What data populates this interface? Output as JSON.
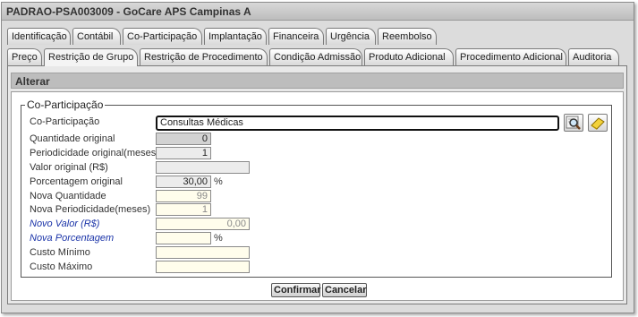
{
  "window": {
    "title": "PADRAO-PSA003009 - GoCare APS Campinas A"
  },
  "tabs_row1": [
    {
      "label": "Identificação"
    },
    {
      "label": "Contábil"
    },
    {
      "label": "Co-Participação"
    },
    {
      "label": "Implantação"
    },
    {
      "label": "Financeira"
    },
    {
      "label": "Urgência"
    },
    {
      "label": "Reembolso"
    }
  ],
  "tabs_row2": [
    {
      "label": "Preço"
    },
    {
      "label": "Restrição de Grupo",
      "active": true
    },
    {
      "label": "Restrição de Procedimento"
    },
    {
      "label": "Condição Admissão"
    },
    {
      "label": "Produto Adicional"
    },
    {
      "label": "Procedimento Adicional"
    },
    {
      "label": "Auditoria"
    }
  ],
  "section": {
    "title": "Alterar"
  },
  "group": {
    "legend": "Co-Participação",
    "fields": {
      "coparticipacao": {
        "label": "Co-Participação",
        "value": "Consultas Médicas"
      },
      "quantidade_original": {
        "label": "Quantidade original",
        "value": "0"
      },
      "periodicidade_original": {
        "label": "Periodicidade original(meses)",
        "value": "1"
      },
      "valor_original": {
        "label": "Valor original (R$)",
        "value": ""
      },
      "porcentagem_original": {
        "label": "Porcentagem original",
        "value": "30,00",
        "unit": "%"
      },
      "nova_quantidade": {
        "label": "Nova Quantidade",
        "value": "99"
      },
      "nova_periodicidade": {
        "label": "Nova Periodicidade(meses)",
        "value": "1"
      },
      "novo_valor": {
        "label": "Novo Valor (R$)",
        "value": "0,00"
      },
      "nova_porcentagem": {
        "label": "Nova Porcentagem",
        "value": "",
        "unit": "%"
      },
      "custo_minimo": {
        "label": "Custo Mínimo",
        "value": ""
      },
      "custo_maximo": {
        "label": "Custo Máximo",
        "value": ""
      }
    },
    "icons": {
      "search": "magnifier-icon",
      "clear": "eraser-icon"
    }
  },
  "actions": {
    "confirm_label": "Confirmar",
    "cancel_label": "Cancelar"
  }
}
